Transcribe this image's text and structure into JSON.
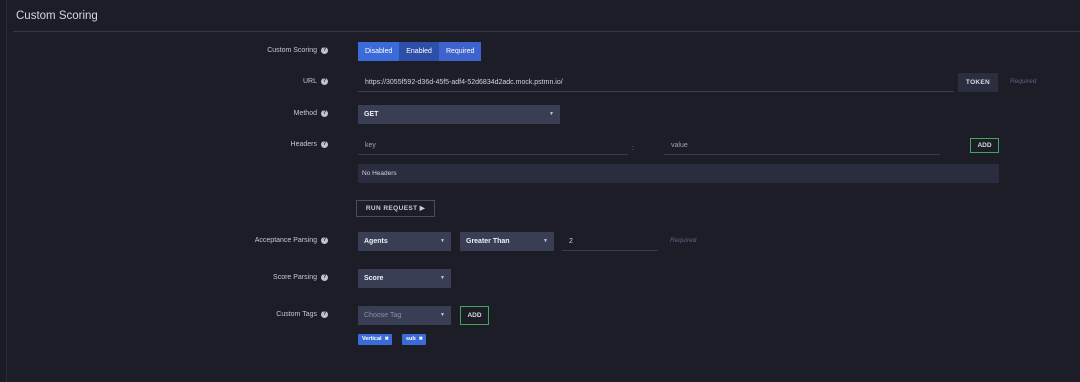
{
  "section": {
    "title": "Custom Scoring"
  },
  "custom_scoring": {
    "label": "Custom Scoring",
    "options": [
      "Disabled",
      "Enabled",
      "Required"
    ],
    "selected": "Disabled"
  },
  "url": {
    "label": "URL",
    "value": "https://3055f592-d36d-45f5-adf4-52d6834d2adc.mock.pstmn.io/",
    "token_label": "TOKEN",
    "required_hint": "Required"
  },
  "method": {
    "label": "Method",
    "value": "GET"
  },
  "headers": {
    "label": "Headers",
    "key_placeholder": "key",
    "value_placeholder": "value",
    "separator": ":",
    "add_label": "ADD",
    "empty_text": "No Headers"
  },
  "run_request": {
    "label": "RUN REQUEST ▶"
  },
  "acceptance_parsing": {
    "label": "Acceptance Parsing",
    "field": "Agents",
    "operator": "Greater Than",
    "value": "2",
    "required_hint": "Required"
  },
  "score_parsing": {
    "label": "Score Parsing",
    "value": "Score"
  },
  "custom_tags": {
    "label": "Custom Tags",
    "placeholder": "Choose Tag",
    "add_label": "ADD",
    "tags": [
      "Vertical",
      "sub"
    ]
  },
  "icons": {
    "help": "help-circle-icon",
    "caret": "caret-down-icon",
    "remove": "close-icon"
  }
}
